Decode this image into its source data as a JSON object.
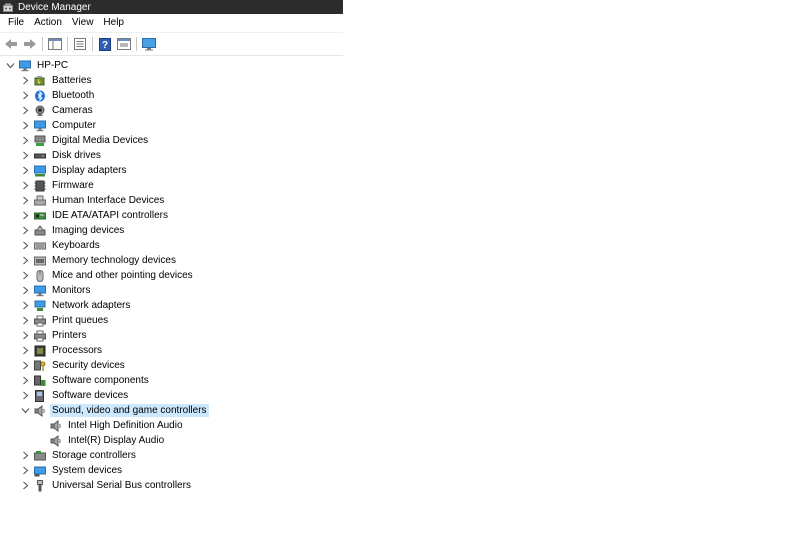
{
  "window": {
    "title": "Device Manager"
  },
  "menu": [
    "File",
    "Action",
    "View",
    "Help"
  ],
  "toolbar": [
    "back-arrow-icon",
    "forward-arrow-icon",
    "show-hide-tree-icon",
    "properties-icon",
    "help-icon",
    "details-pane-icon",
    "monitor-icon"
  ],
  "tree": {
    "root": {
      "label": "HP-PC",
      "expanded": true,
      "icon": "computer-icon"
    },
    "categories": [
      {
        "label": "Batteries",
        "icon": "battery-icon",
        "expanded": false
      },
      {
        "label": "Bluetooth",
        "icon": "bluetooth-icon",
        "expanded": false
      },
      {
        "label": "Cameras",
        "icon": "camera-icon",
        "expanded": false
      },
      {
        "label": "Computer",
        "icon": "computer-icon",
        "expanded": false
      },
      {
        "label": "Digital Media Devices",
        "icon": "media-device-icon",
        "expanded": false
      },
      {
        "label": "Disk drives",
        "icon": "disk-drive-icon",
        "expanded": false
      },
      {
        "label": "Display adapters",
        "icon": "display-adapter-icon",
        "expanded": false
      },
      {
        "label": "Firmware",
        "icon": "firmware-icon",
        "expanded": false
      },
      {
        "label": "Human Interface Devices",
        "icon": "hid-icon",
        "expanded": false
      },
      {
        "label": "IDE ATA/ATAPI controllers",
        "icon": "ide-controller-icon",
        "expanded": false
      },
      {
        "label": "Imaging devices",
        "icon": "imaging-icon",
        "expanded": false
      },
      {
        "label": "Keyboards",
        "icon": "keyboard-icon",
        "expanded": false
      },
      {
        "label": "Memory technology devices",
        "icon": "memory-icon",
        "expanded": false
      },
      {
        "label": "Mice and other pointing devices",
        "icon": "mouse-icon",
        "expanded": false
      },
      {
        "label": "Monitors",
        "icon": "monitor-icon",
        "expanded": false
      },
      {
        "label": "Network adapters",
        "icon": "network-adapter-icon",
        "expanded": false
      },
      {
        "label": "Print queues",
        "icon": "printer-icon",
        "expanded": false
      },
      {
        "label": "Printers",
        "icon": "printer-icon",
        "expanded": false
      },
      {
        "label": "Processors",
        "icon": "processor-icon",
        "expanded": false
      },
      {
        "label": "Security devices",
        "icon": "security-key-icon",
        "expanded": false
      },
      {
        "label": "Software components",
        "icon": "software-component-icon",
        "expanded": false
      },
      {
        "label": "Software devices",
        "icon": "software-device-icon",
        "expanded": false
      },
      {
        "label": "Sound, video and game controllers",
        "icon": "speaker-icon",
        "expanded": true,
        "selected": true,
        "children": [
          {
            "label": "Intel High Definition Audio",
            "icon": "speaker-icon"
          },
          {
            "label": "Intel(R) Display Audio",
            "icon": "speaker-icon"
          }
        ]
      },
      {
        "label": "Storage controllers",
        "icon": "storage-controller-icon",
        "expanded": false
      },
      {
        "label": "System devices",
        "icon": "system-device-icon",
        "expanded": false
      },
      {
        "label": "Universal Serial Bus controllers",
        "icon": "usb-icon",
        "expanded": false
      }
    ]
  }
}
